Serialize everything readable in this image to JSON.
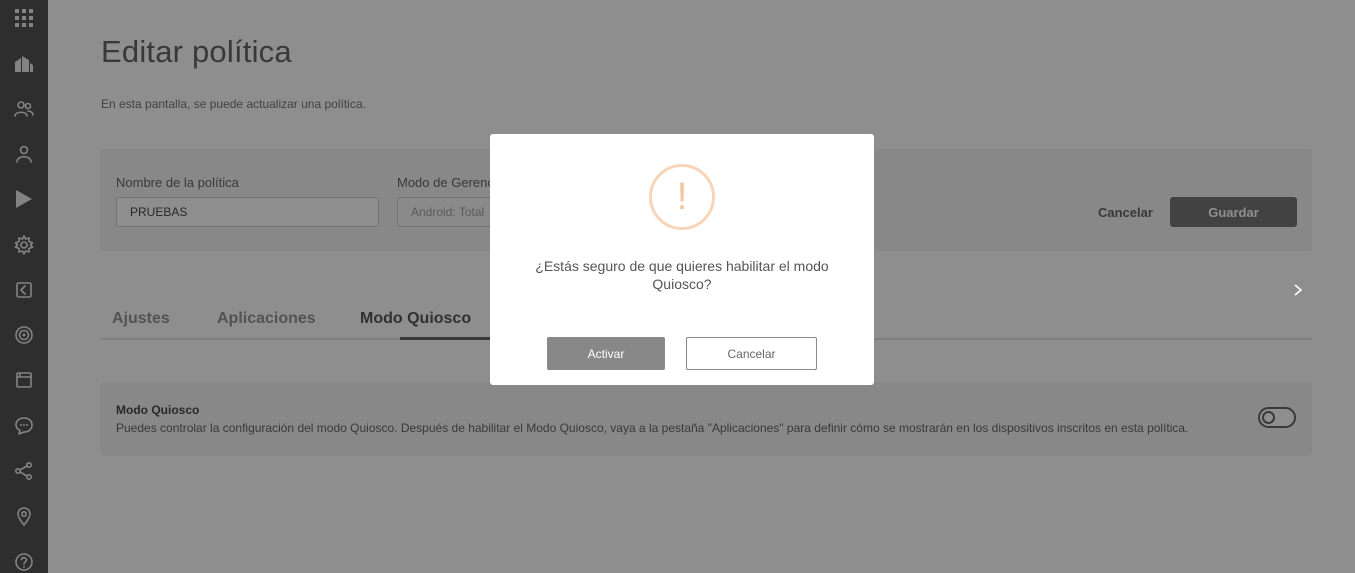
{
  "sidebar": {
    "items": [
      {
        "icon": "apps-grid-icon"
      },
      {
        "icon": "building-icon"
      },
      {
        "icon": "users-icon"
      },
      {
        "icon": "user-icon"
      },
      {
        "icon": "play-store-icon"
      },
      {
        "icon": "settings-gear-icon"
      },
      {
        "icon": "collapse-sidebar-icon"
      },
      {
        "icon": "target-icon"
      },
      {
        "icon": "browser-window-icon"
      },
      {
        "icon": "chat-bubble-icon"
      },
      {
        "icon": "share-icon"
      },
      {
        "icon": "location-pin-icon"
      },
      {
        "icon": "help-icon"
      }
    ]
  },
  "page": {
    "title": "Editar política",
    "subtitle": "En esta pantalla, se puede actualizar una política."
  },
  "form": {
    "policy_name_label": "Nombre de la política",
    "policy_name_value": "PRUEBAS",
    "management_mode_label": "Modo de Gerenc",
    "management_mode_value": "Android: Total",
    "cancel_label": "Cancelar",
    "save_label": "Guardar"
  },
  "tabs": [
    {
      "label": "Ajustes"
    },
    {
      "label": "Aplicaciones"
    },
    {
      "label": "Modo Quiosco",
      "active": true
    }
  ],
  "kiosk": {
    "title": "Modo Quiosco",
    "description": "Puedes controlar la configuración del modo Quiosco. Después de habilitar el Modo Quiosco, vaya a la pestaña \"Aplicaciones\" para definir cómo se mostrarán en los dispositivos inscritos en esta política.",
    "enabled": false
  },
  "modal": {
    "icon_glyph": "!",
    "message": "¿Estás seguro de que quieres habilitar el modo Quiosco?",
    "activate_label": "Activar",
    "cancel_label": "Cancelar"
  },
  "colors": {
    "sidebar_bg": "#3f3f3f",
    "warning_accent": "#f5c49a",
    "primary_button": "#666666"
  }
}
